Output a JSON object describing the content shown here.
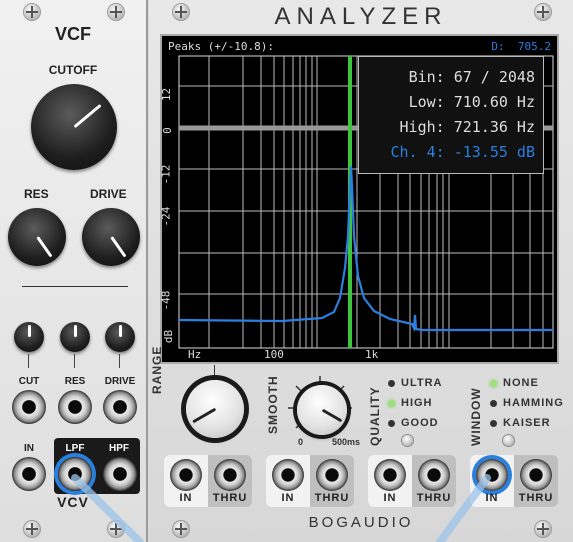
{
  "vcf": {
    "title": "VCF",
    "cutoff_label": "CUTOFF",
    "res_label": "RES",
    "drive_label": "DRIVE",
    "cv_labels": [
      "CUT",
      "RES",
      "DRIVE"
    ],
    "in_label": "IN",
    "lpf_label": "LPF",
    "hpf_label": "HPF",
    "brand": "VCV"
  },
  "analyzer": {
    "title": "ANALYZER",
    "brand": "BOGAUDIO",
    "display": {
      "peaks_label": "Peaks (+/-10.8):",
      "d_label": "D:",
      "d_value": "705.2",
      "readout_bin": "Bin: 67 / 2048",
      "readout_low": "Low: 710.60 Hz",
      "readout_high": "High: 721.36 Hz",
      "readout_ch": "Ch. 4: -13.55 dB",
      "y_ticks": [
        "12",
        "0",
        "-12",
        "-24",
        "-48",
        "dB"
      ],
      "x_ticks": [
        "Hz",
        "100",
        "1k"
      ]
    },
    "range_label": "RANGE",
    "smooth_label": "SMOOTH",
    "smooth_min": "0",
    "smooth_max": "500ms",
    "quality_label": "QUALITY",
    "quality_options": [
      "ULTRA",
      "HIGH",
      "GOOD"
    ],
    "quality_selected": "HIGH",
    "window_label": "WINDOW",
    "window_options": [
      "NONE",
      "HAMMING",
      "KAISER"
    ],
    "window_selected": "NONE",
    "io": [
      {
        "in": "IN",
        "thru": "THRU"
      },
      {
        "in": "IN",
        "thru": "THRU"
      },
      {
        "in": "IN",
        "thru": "THRU"
      },
      {
        "in": "IN",
        "thru": "THRU"
      }
    ]
  },
  "colors": {
    "spectrum": "#2a7fe0",
    "marker": "#3ec43e",
    "readout_highlight": "#2a7fe0",
    "cable": "#bcd6ee"
  }
}
